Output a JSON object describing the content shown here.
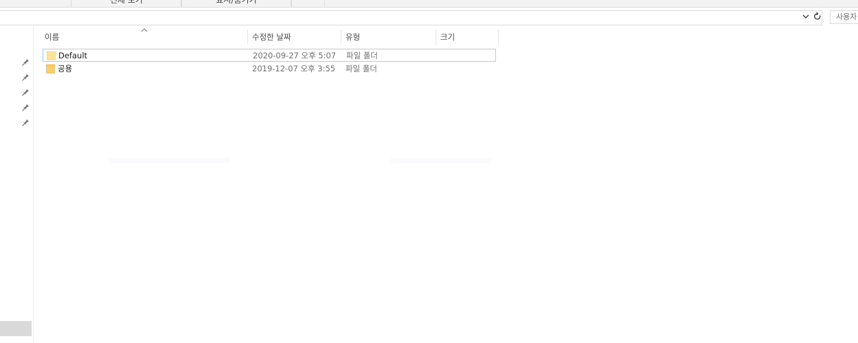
{
  "ribbon": {
    "group1_label": "전체 보기",
    "group2_label": "표시/숨기기"
  },
  "address_bar": {
    "search_placeholder": "사용자"
  },
  "columns": {
    "name": "이름",
    "modified": "수정한 날짜",
    "type": "유형",
    "size": "크기"
  },
  "files": [
    {
      "name": "Default",
      "modified": "2020-09-27 오후 5:07",
      "type": "파일 폴더",
      "size": ""
    },
    {
      "name": "공용",
      "modified": "2019-12-07 오후 3:55",
      "type": "파일 폴더",
      "size": ""
    }
  ],
  "icons": {
    "folder_color": "#f7c85e",
    "folder_light_color": "#fde7a8",
    "selection_border": "#99d1ff",
    "pin": "pin-icon",
    "folder": "folder-icon",
    "refresh": "refresh-icon",
    "chevron": "chevron-down-icon",
    "sort": "sort-ascending-icon"
  }
}
